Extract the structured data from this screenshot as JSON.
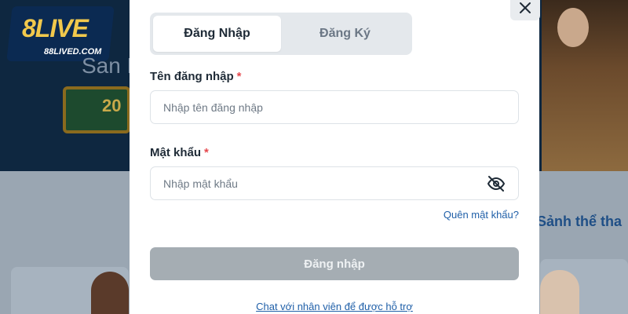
{
  "background": {
    "logo_main": "8LIVE",
    "logo_sub": "88LIVED.COM",
    "banner_partial_text": "San N",
    "board_partial_text": "20",
    "right_heading_partial": "Sảnh thể tha"
  },
  "modal": {
    "tabs": [
      {
        "label": "Đăng Nhập",
        "active": true
      },
      {
        "label": "Đăng Ký",
        "active": false
      }
    ],
    "username": {
      "label": "Tên đăng nhập",
      "required_mark": "*",
      "placeholder": "Nhập tên đăng nhập",
      "value": ""
    },
    "password": {
      "label": "Mật khẩu",
      "required_mark": "*",
      "placeholder": "Nhập mật khẩu",
      "value": "",
      "toggle_icon": "eye-slash-icon"
    },
    "forgot_password": "Quên mật khẩu?",
    "submit_label": "Đăng nhập",
    "support_link": "Chat với nhân viên để được hỗ trợ",
    "close_icon": "close-icon"
  },
  "colors": {
    "link": "#1f5fa8",
    "required": "#e5484d",
    "submit_disabled": "#a5adb3",
    "overlay_banner": "#0e2740"
  }
}
